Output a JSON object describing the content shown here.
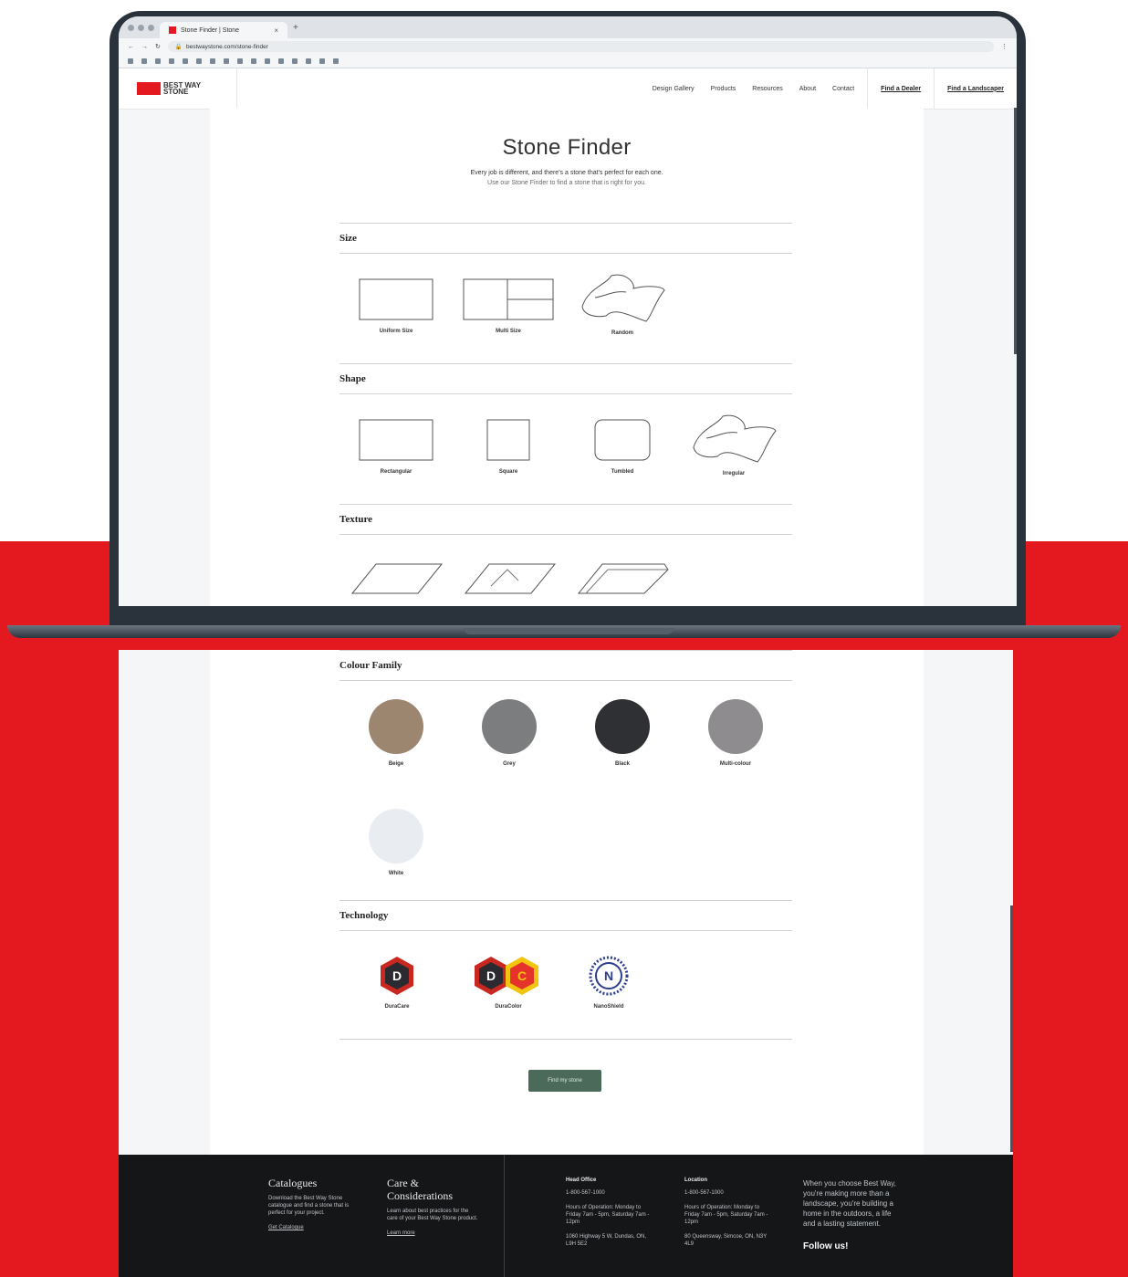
{
  "browser": {
    "tab_title": "Stone Finder | Stone",
    "new_tab_symbol": "+",
    "url": "bestwaystone.com/stone-finder"
  },
  "site": {
    "logo_text": "BEST WAY STONE",
    "nav": [
      "Design Gallery",
      "Products",
      "Resources",
      "About",
      "Contact"
    ],
    "cta_primary": "Find a Dealer",
    "cta_secondary": "Find a Landscaper"
  },
  "finder": {
    "title": "Stone Finder",
    "subtitle_line1": "Every job is different, and there's a stone that's perfect for each one.",
    "subtitle_line2": "Use our Stone Finder to find a stone that is right for you.",
    "size": {
      "heading": "Size",
      "options": [
        "Uniform Size",
        "Multi Size",
        "Random"
      ]
    },
    "shape": {
      "heading": "Shape",
      "options": [
        "Rectangular",
        "Square",
        "Tumbled",
        "Irregular"
      ]
    },
    "texture": {
      "heading": "Texture"
    },
    "colour": {
      "heading": "Colour Family",
      "options": [
        {
          "label": "Beige",
          "color": "#9c8670"
        },
        {
          "label": "Grey",
          "color": "#7b7d7f"
        },
        {
          "label": "Black",
          "color": "#2e3033"
        },
        {
          "label": "Multi-colour",
          "color": "#8e8c8e"
        },
        {
          "label": "White",
          "color": "#e9edf2"
        }
      ]
    },
    "technology": {
      "heading": "Technology",
      "options": [
        {
          "label": "DuraCare",
          "letters": "D"
        },
        {
          "label": "DuraColor",
          "letters": "DC"
        },
        {
          "label": "NanoShield",
          "letters": "N"
        }
      ]
    },
    "find_button": "Find my stone"
  },
  "footer": {
    "catalogues_title": "Catalogues",
    "catalogues_text": "Download the Best Way Stone catalogue and find a stone that is perfect for your project.",
    "catalogues_link": "Get Catalogue",
    "care_title_line1": "Care &",
    "care_title_line2": "Considerations",
    "care_text": "Learn about best practices for the care of your Best Way Stone product.",
    "care_link": "Learn more",
    "office1_title": "Head Office",
    "office1_phone": "1-800-567-1000",
    "office1_hours": "Hours of Operation: Monday to Friday 7am - 5pm, Saturday 7am - 12pm",
    "office1_address": "1060 Highway 5 W, Dundas, ON, L9H 5E2",
    "office2_title": "Location",
    "office2_phone": "1-800-567-1000",
    "office2_hours": "Hours of Operation: Monday to Friday 7am - 5pm, Saturday 7am - 12pm",
    "office2_address": "80 Queensway, Simcoe, ON, N3Y 4L9",
    "tagline": "When you choose Best Way, you're making more than a landscape, you're building a home in the outdoors, a life and a lasting statement.",
    "follow": "Follow us!"
  }
}
